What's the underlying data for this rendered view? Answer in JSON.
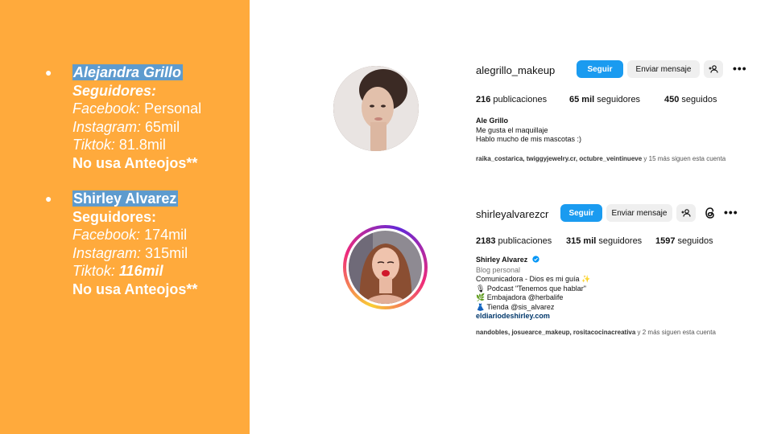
{
  "left": {
    "person1": {
      "bullet": "●",
      "name": "Alejandra Grillo",
      "seguidores": "Seguidores:",
      "fb_label": "Facebook:",
      "fb_value": " Personal",
      "ig_label": "Instagram:",
      "ig_value": " 65mil",
      "tt_label": "Tiktok:",
      "tt_value": " 81.8mil",
      "note": "No usa Anteojos**"
    },
    "person2": {
      "bullet": "●",
      "name": "Shirley Alvarez",
      "seguidores": "Seguidores:",
      "fb_label": "Facebook:",
      "fb_value": " 174mil",
      "ig_label": "Instagram:",
      "ig_value": " 315mil",
      "tt_label": "Tiktok:",
      "tt_value": " 116mil",
      "note": "No usa Anteojos**"
    }
  },
  "profiles": [
    {
      "username": "alegrillo_makeup",
      "follow": "Seguir",
      "message": "Enviar mensaje",
      "add_icon": "add-person-icon",
      "more": "•••",
      "posts_num": "216",
      "posts_label": " publicaciones",
      "followers_num": "65 mil",
      "followers_label": " seguidores",
      "following_num": "450",
      "following_label": " seguidos",
      "bio_name": "Ale Grillo",
      "bio_1": "Me gusta el maquillaje",
      "bio_2": "Hablo mucho de mis mascotas :)",
      "followed_names": "raika_costarica, twiggyjewelry.cr, octubre_veintinueve",
      "followed_rest": " y 15 más siguen esta cuenta"
    },
    {
      "username": "shirleyalvarezcr",
      "follow": "Seguir",
      "message": "Enviar mensaje",
      "add_icon": "add-person-icon",
      "threads_icon": "threads-icon",
      "more": "•••",
      "posts_num": "2183",
      "posts_label": " publicaciones",
      "followers_num": "315 mil",
      "followers_label": " seguidores",
      "following_num": "1597",
      "following_label": " seguidos",
      "bio_name": "Shirley Alvarez",
      "verified_icon": "verified-badge-icon",
      "category": "Blog personal",
      "bio_1": "Comunicadora - Dios es mi guía ✨",
      "bio_2": "🎙 Podcast \"Tenemos que hablar\"",
      "bio_3": "🌿 Embajadora @herbalife",
      "bio_4": "👗 Tienda @sis_alvarez",
      "link": "eldiariodeshirley.com",
      "followed_names": "nandobles, josuearce_makeup, rositacocinacreativa",
      "followed_rest": " y 2 más siguen esta cuenta"
    }
  ],
  "colors": {
    "panel": "#FFAA3C",
    "highlight": "#5E9BCE",
    "follow_button": "#1A9BF0",
    "ring_start": "#F9CE34",
    "ring_mid": "#EE2A7B",
    "ring_end": "#6228D7"
  }
}
